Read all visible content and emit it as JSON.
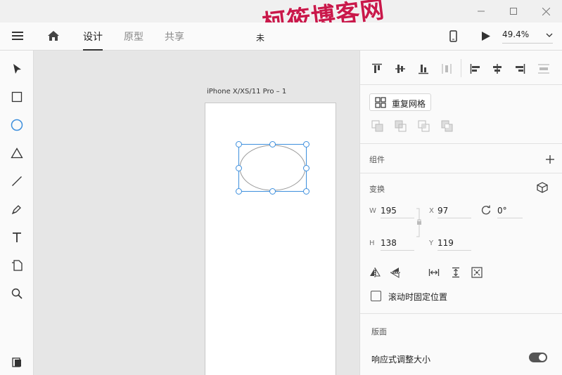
{
  "titlebar": {
    "watermark": "柯筱博客网",
    "minimize_icon": "minimize-icon",
    "maximize_icon": "maximize-icon",
    "close_icon": "close-icon"
  },
  "header": {
    "tabs": [
      {
        "label": "设计",
        "active": true
      },
      {
        "label": "原型",
        "active": false
      },
      {
        "label": "共享",
        "active": false
      }
    ],
    "doc_title": "未",
    "zoom": "49.4%"
  },
  "toolbar": {
    "tools": [
      "select",
      "rectangle",
      "ellipse",
      "polygon",
      "line",
      "pen",
      "text",
      "artboard",
      "zoom"
    ],
    "active_tool": "ellipse"
  },
  "canvas": {
    "artboard_label": "iPhone X/XS/11 Pro – 1"
  },
  "panel": {
    "repeat_grid_label": "重复网格",
    "components_title": "组件",
    "transform_title": "变换",
    "w_label": "W",
    "w_value": "195",
    "x_label": "X",
    "x_value": "97",
    "rotation_value": "0°",
    "h_label": "H",
    "h_value": "138",
    "y_label": "Y",
    "y_value": "119",
    "fixed_scroll_label": "滚动时固定位置",
    "layout_title": "版面",
    "responsive_label": "响应式调整大小"
  },
  "colors": {
    "accent": "#3d8fdd",
    "watermark": "#c9184a"
  }
}
